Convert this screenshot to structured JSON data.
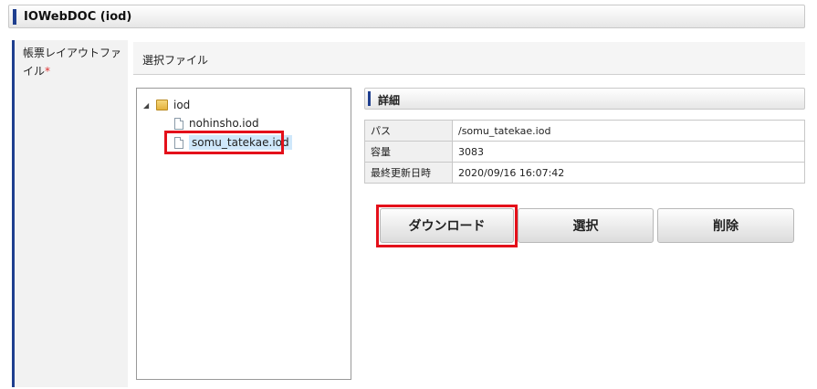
{
  "panel": {
    "title": "IOWebDOC (iod)"
  },
  "field": {
    "label": "帳票レイアウトファイル",
    "required_mark": "*"
  },
  "selector": {
    "header": "選択ファイル"
  },
  "tree": {
    "root": {
      "label": "iod"
    },
    "files": [
      {
        "label": "nohinsho.iod",
        "selected": false
      },
      {
        "label": "somu_tatekae.iod",
        "selected": true
      }
    ]
  },
  "detail": {
    "title": "詳細",
    "rows": [
      {
        "key": "パス",
        "value": "/somu_tatekae.iod"
      },
      {
        "key": "容量",
        "value": "3083"
      },
      {
        "key": "最終更新日時",
        "value": "2020/09/16 16:07:42"
      }
    ]
  },
  "buttons": {
    "download": "ダウンロード",
    "select": "選択",
    "delete": "削除"
  },
  "colors": {
    "accent": "#1f3f8f",
    "highlight": "#e4101a",
    "selection": "#cfe8fb",
    "required": "#dd3333"
  },
  "icons": {
    "folder": "folder-icon",
    "file": "file-icon",
    "expand": "triangle-down-icon"
  }
}
